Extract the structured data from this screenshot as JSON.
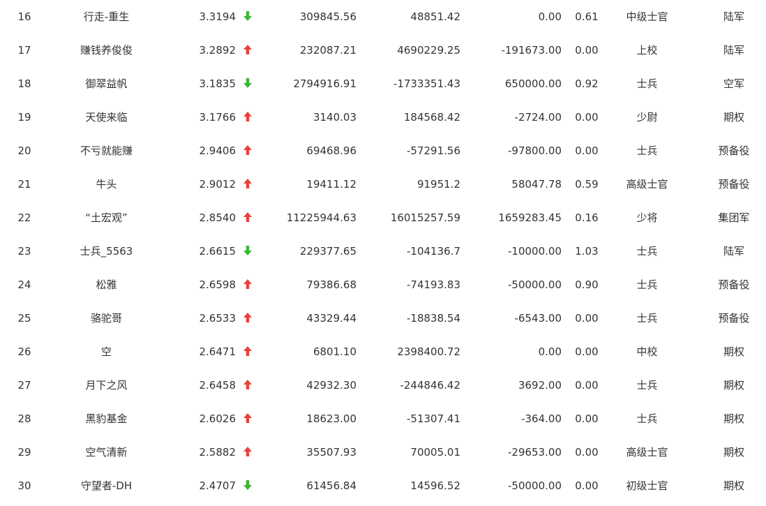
{
  "colors": {
    "up": "#e8413b",
    "down": "#3cb535",
    "text": "#333333"
  },
  "rows": [
    {
      "rank": "16",
      "name": "行走-重生",
      "score": "3.3194",
      "trend": "down",
      "v1": "309845.56",
      "v2": "48851.42",
      "v3": "0.00",
      "v4": "0.61",
      "title": "中级士官",
      "group": "陆军"
    },
    {
      "rank": "17",
      "name": "赚钱养俊俊",
      "score": "3.2892",
      "trend": "up",
      "v1": "232087.21",
      "v2": "4690229.25",
      "v3": "-191673.00",
      "v4": "0.00",
      "title": "上校",
      "group": "陆军"
    },
    {
      "rank": "18",
      "name": "御翠益帆",
      "score": "3.1835",
      "trend": "down",
      "v1": "2794916.91",
      "v2": "-1733351.43",
      "v3": "650000.00",
      "v4": "0.92",
      "title": "士兵",
      "group": "空军"
    },
    {
      "rank": "19",
      "name": "天使来临",
      "score": "3.1766",
      "trend": "up",
      "v1": "3140.03",
      "v2": "184568.42",
      "v3": "-2724.00",
      "v4": "0.00",
      "title": "少尉",
      "group": "期权"
    },
    {
      "rank": "20",
      "name": "不亏就能赚",
      "score": "2.9406",
      "trend": "up",
      "v1": "69468.96",
      "v2": "-57291.56",
      "v3": "-97800.00",
      "v4": "0.00",
      "title": "士兵",
      "group": "预备役"
    },
    {
      "rank": "21",
      "name": "牛头",
      "score": "2.9012",
      "trend": "up",
      "v1": "19411.12",
      "v2": "91951.2",
      "v3": "58047.78",
      "v4": "0.59",
      "title": "高级士官",
      "group": "预备役"
    },
    {
      "rank": "22",
      "name": "“土宏观”",
      "score": "2.8540",
      "trend": "up",
      "v1": "11225944.63",
      "v2": "16015257.59",
      "v3": "1659283.45",
      "v4": "0.16",
      "title": "少将",
      "group": "集团军"
    },
    {
      "rank": "23",
      "name": "士兵_5563",
      "score": "2.6615",
      "trend": "down",
      "v1": "229377.65",
      "v2": "-104136.7",
      "v3": "-10000.00",
      "v4": "1.03",
      "title": "士兵",
      "group": "陆军"
    },
    {
      "rank": "24",
      "name": "松雅",
      "score": "2.6598",
      "trend": "up",
      "v1": "79386.68",
      "v2": "-74193.83",
      "v3": "-50000.00",
      "v4": "0.90",
      "title": "士兵",
      "group": "预备役"
    },
    {
      "rank": "25",
      "name": "骆驼哥",
      "score": "2.6533",
      "trend": "up",
      "v1": "43329.44",
      "v2": "-18838.54",
      "v3": "-6543.00",
      "v4": "0.00",
      "title": "士兵",
      "group": "预备役"
    },
    {
      "rank": "26",
      "name": "空",
      "score": "2.6471",
      "trend": "up",
      "v1": "6801.10",
      "v2": "2398400.72",
      "v3": "0.00",
      "v4": "0.00",
      "title": "中校",
      "group": "期权"
    },
    {
      "rank": "27",
      "name": "月下之风",
      "score": "2.6458",
      "trend": "up",
      "v1": "42932.30",
      "v2": "-244846.42",
      "v3": "3692.00",
      "v4": "0.00",
      "title": "士兵",
      "group": "期权"
    },
    {
      "rank": "28",
      "name": "黑豹基金",
      "score": "2.6026",
      "trend": "up",
      "v1": "18623.00",
      "v2": "-51307.41",
      "v3": "-364.00",
      "v4": "0.00",
      "title": "士兵",
      "group": "期权"
    },
    {
      "rank": "29",
      "name": "空气清新",
      "score": "2.5882",
      "trend": "up",
      "v1": "35507.93",
      "v2": "70005.01",
      "v3": "-29653.00",
      "v4": "0.00",
      "title": "高级士官",
      "group": "期权"
    },
    {
      "rank": "30",
      "name": "守望者-DH",
      "score": "2.4707",
      "trend": "down",
      "v1": "61456.84",
      "v2": "14596.52",
      "v3": "-50000.00",
      "v4": "0.00",
      "title": "初级士官",
      "group": "期权"
    }
  ]
}
